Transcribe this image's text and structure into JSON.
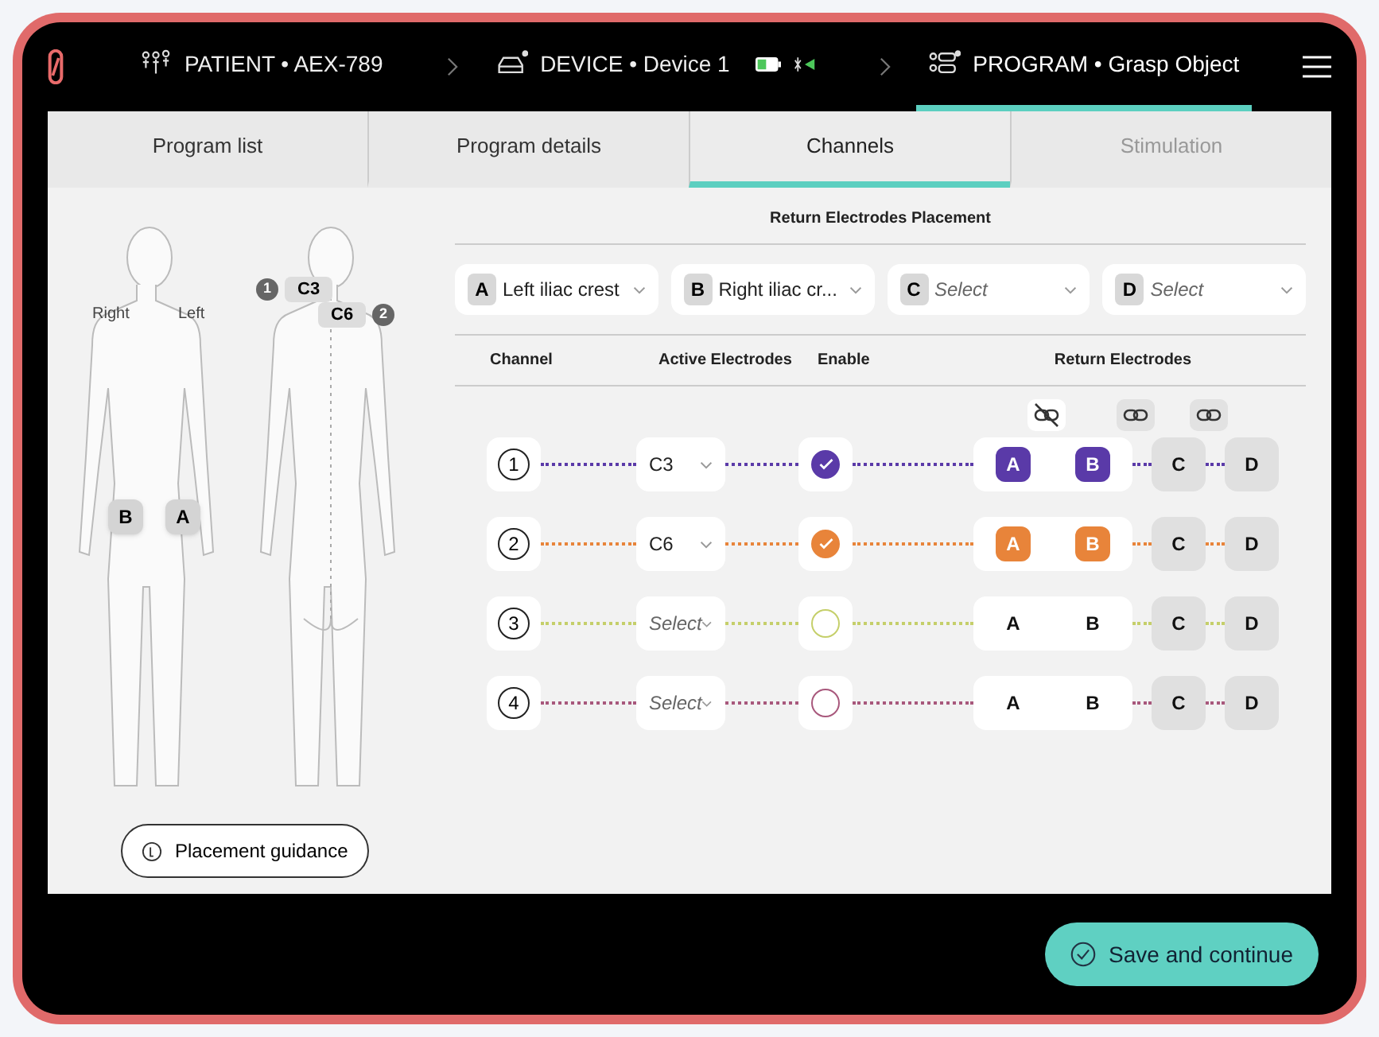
{
  "header": {
    "breadcrumbs": [
      {
        "kind": "patient",
        "text": "PATIENT • AEX-789",
        "selected": false
      },
      {
        "kind": "device",
        "text": "DEVICE • Device 1",
        "selected": false
      },
      {
        "kind": "program",
        "text": "PROGRAM • Grasp Object",
        "selected": true
      }
    ]
  },
  "tabs": [
    {
      "label": "Program list",
      "selected": false,
      "disabled": false
    },
    {
      "label": "Program details",
      "selected": false,
      "disabled": false
    },
    {
      "label": "Channels",
      "selected": true,
      "disabled": false
    },
    {
      "label": "Stimulation",
      "selected": false,
      "disabled": true
    }
  ],
  "body_map": {
    "side_labels": [
      "Right",
      "Left"
    ],
    "front_markers": [
      {
        "letter": "B"
      },
      {
        "letter": "A"
      }
    ],
    "back_markers": [
      {
        "number": "1",
        "label": "C3"
      },
      {
        "number": "2",
        "label": "C6"
      }
    ],
    "guidance_button": "Placement guidance"
  },
  "return_placement": {
    "title": "Return Electrodes Placement",
    "electrodes": [
      {
        "letter": "A",
        "value": "Left iliac crest"
      },
      {
        "letter": "B",
        "value": "Right iliac cr..."
      },
      {
        "letter": "C",
        "placeholder": "Select"
      },
      {
        "letter": "D",
        "placeholder": "Select"
      }
    ]
  },
  "channel_table": {
    "columns": [
      "Channel",
      "Active Electrodes",
      "Enable",
      "Return Electrodes"
    ],
    "link_toggles": [
      {
        "linked": false
      },
      {
        "linked": true
      },
      {
        "linked": true
      }
    ],
    "rows": [
      {
        "number": "1",
        "color": "#5a3aa8",
        "active": {
          "value": "C3"
        },
        "enabled": true,
        "returns": [
          {
            "letter": "A",
            "selected": true
          },
          {
            "letter": "B",
            "selected": true
          },
          {
            "letter": "C",
            "selected": false
          },
          {
            "letter": "D",
            "selected": false
          }
        ]
      },
      {
        "number": "2",
        "color": "#e8843a",
        "active": {
          "value": "C6"
        },
        "enabled": true,
        "returns": [
          {
            "letter": "A",
            "selected": true
          },
          {
            "letter": "B",
            "selected": true
          },
          {
            "letter": "C",
            "selected": false
          },
          {
            "letter": "D",
            "selected": false
          }
        ]
      },
      {
        "number": "3",
        "color": "#c5cf6a",
        "active": {
          "placeholder": "Select"
        },
        "enabled": false,
        "returns": [
          {
            "letter": "A",
            "selected": false
          },
          {
            "letter": "B",
            "selected": false
          },
          {
            "letter": "C",
            "selected": false
          },
          {
            "letter": "D",
            "selected": false
          }
        ]
      },
      {
        "number": "4",
        "color": "#a8587c",
        "active": {
          "placeholder": "Select"
        },
        "enabled": false,
        "returns": [
          {
            "letter": "A",
            "selected": false
          },
          {
            "letter": "B",
            "selected": false
          },
          {
            "letter": "C",
            "selected": false
          },
          {
            "letter": "D",
            "selected": false
          }
        ]
      }
    ]
  },
  "footer": {
    "save_button": "Save and continue"
  }
}
